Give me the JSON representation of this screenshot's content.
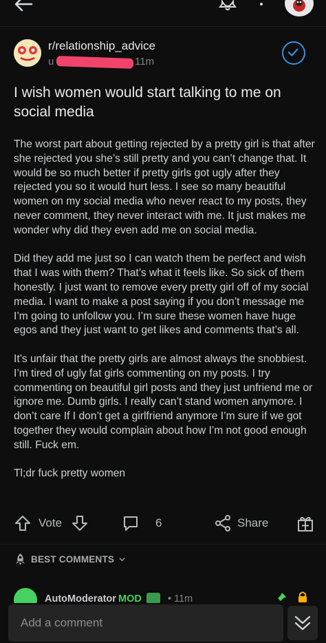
{
  "header": {
    "back_icon": "arrow-left-icon",
    "bell_icon": "bell-icon",
    "menu_icon": "more-vertical-icon"
  },
  "post": {
    "subreddit": "r/relationship_advice",
    "author_prefix": "u",
    "time": "11m",
    "title": "I wish women would start talking to me on social media",
    "paragraphs": [
      "The worst part about getting rejected by a pretty girl is that after she rejected you she’s still pretty and you can’t change that. It would be so much better if pretty girls got ugly after they rejected you so it would hurt less. I see so many beautiful women on my social media who never react to my posts, they never comment, they never interact with me. It just makes me wonder why did they even add me on social media.",
      "Did they add me just so I can watch them be perfect and wish that I was with them? That’s what it feels like. So sick of them honestly. I just want to remove every pretty girl off of my social media. I want to make a post saying if you don’t message me I’m going to unfollow you. I’m sure these women have huge egos and they just want to get likes and comments that’s all.",
      "It’s unfair that the pretty girls are almost always the snobbiest. I’m tired of ugly fat girls commenting on my posts. I try commenting on beautiful girl posts and they just unfriend me or ignore me. Dumb girls. I really can’t stand women anymore. I don’t care If I don’t get a girlfriend anymore I’m sure if we got together they would complain about how I’m not good enough still. Fuck em.",
      "Tl;dr fuck pretty women"
    ]
  },
  "actions": {
    "vote_label": "Vote",
    "comment_count": "6",
    "share_label": "Share"
  },
  "comments": {
    "sort_label": "BEST COMMENTS",
    "first": {
      "author": "AutoModerator",
      "mod_badge": "MOD",
      "time": "• 11m"
    },
    "add_placeholder": "Add a comment"
  },
  "colors": {
    "background": "#0e0e0e",
    "accent_blue": "#3d8fe0",
    "mod_green": "#46d160",
    "redaction": "#f0446a",
    "lock_orange": "#ffb000"
  }
}
